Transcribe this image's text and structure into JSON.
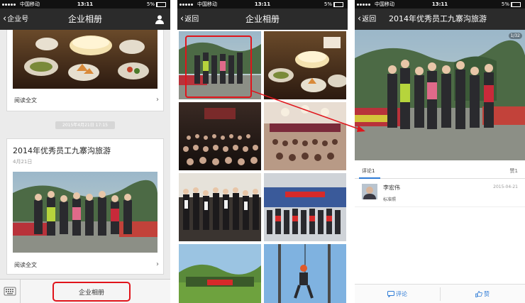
{
  "status_bar": {
    "carrier": "中国移动",
    "time": "13:11",
    "battery": "5%"
  },
  "screen1": {
    "nav": {
      "back_label": "企业号",
      "title": "企业相册"
    },
    "card1": {
      "read_full": "阅读全文"
    },
    "date_chip": "2015年4月21日 17:15",
    "card2": {
      "title": "2014年优秀员工九寨沟旅游",
      "date": "4月21日",
      "read_full": "阅读全文"
    },
    "bottom_menu": {
      "button_label": "企业相册"
    }
  },
  "screen2": {
    "nav": {
      "back_label": "返回",
      "title": "企业相册"
    }
  },
  "screen3": {
    "nav": {
      "back_label": "返回",
      "title": "2014年优秀员工九寨沟旅游"
    },
    "photo_counter": "1/32",
    "tabs": {
      "comments_label": "评论",
      "comments_count": "1",
      "likes_label": "赞",
      "likes_count": "1"
    },
    "comment": {
      "name": "李宏伟",
      "date": "2015-04-21",
      "text": "标准照"
    },
    "actions": {
      "comment_label": "评论",
      "like_label": "赞"
    }
  },
  "colors": {
    "highlight": "#e0141b",
    "accent": "#2e7bd6",
    "nav_bg": "#2b2b2b"
  }
}
